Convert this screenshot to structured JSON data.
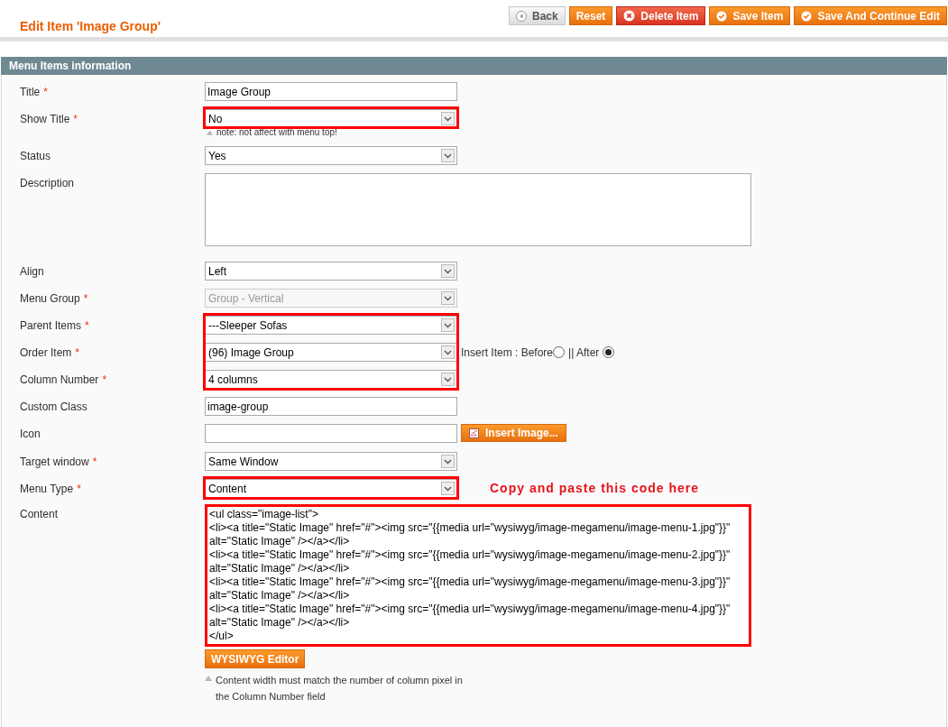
{
  "required_mark": "*",
  "header": {
    "title": "Edit Item 'Image Group'",
    "buttons": [
      {
        "label": "Back",
        "kind": "back"
      },
      {
        "label": "Reset",
        "kind": "plain"
      },
      {
        "label": "Delete Item",
        "kind": "delete"
      },
      {
        "label": "Save Item",
        "kind": "save"
      },
      {
        "label": "Save And Continue Edit",
        "kind": "save"
      }
    ]
  },
  "section": {
    "title": "Menu Items information",
    "fields": [
      {
        "kind": "text",
        "label": "Title",
        "required": true,
        "value": "Image Group",
        "highlighted": false
      },
      {
        "kind": "select",
        "label": "Show Title",
        "required": true,
        "value": "No",
        "disabled": false,
        "highlighted": true,
        "note": "note: not affect with menu top!"
      },
      {
        "kind": "select",
        "label": "Status",
        "required": false,
        "value": "Yes",
        "disabled": false,
        "highlighted": false
      },
      {
        "kind": "textarea",
        "label": "Description",
        "required": false,
        "highlighted": false
      },
      {
        "kind": "select",
        "label": "Align",
        "required": false,
        "value": "Left",
        "disabled": false,
        "highlighted": false
      },
      {
        "kind": "select",
        "label": "Menu Group",
        "required": true,
        "value": "Group - Vertical",
        "disabled": true,
        "highlighted": false
      },
      {
        "kind": "select",
        "label": "Parent Items",
        "required": true,
        "value": "---Sleeper Sofas",
        "disabled": false,
        "highlighted": true
      },
      {
        "kind": "select",
        "label": "Order Item",
        "required": true,
        "value": "(96) Image Group",
        "disabled": false,
        "highlighted": true,
        "insert": {
          "label": "Insert Item : Before",
          "separator": "|| After",
          "options": [
            {
              "selected": false
            },
            {
              "selected": true
            }
          ]
        }
      },
      {
        "kind": "select",
        "label": "Column Number",
        "required": true,
        "value": "4 columns",
        "disabled": false,
        "highlighted": true
      },
      {
        "kind": "text",
        "label": "Custom Class",
        "required": false,
        "value": "image-group",
        "highlighted": false
      },
      {
        "kind": "image",
        "label": "Icon",
        "required": false,
        "button": "Insert Image...",
        "highlighted": false
      },
      {
        "kind": "select",
        "label": "Target window",
        "required": true,
        "value": "Same Window",
        "disabled": false,
        "highlighted": false
      },
      {
        "kind": "select",
        "label": "Menu Type",
        "required": true,
        "value": "Content",
        "disabled": false,
        "highlighted": true,
        "annotation": "Copy and paste this code here"
      },
      {
        "kind": "code",
        "label": "Content",
        "required": false,
        "highlighted": true,
        "value": "<ul class=\"image-list\">\n<li><a title=\"Static Image\" href=\"#\"><img src=\"{{media url=\"wysiwyg/image-megamenu/image-menu-1.jpg\"}}\" alt=\"Static Image\" /></a></li>\n<li><a title=\"Static Image\" href=\"#\"><img src=\"{{media url=\"wysiwyg/image-megamenu/image-menu-2.jpg\"}}\" alt=\"Static Image\" /></a></li>\n<li><a title=\"Static Image\" href=\"#\"><img src=\"{{media url=\"wysiwyg/image-megamenu/image-menu-3.jpg\"}}\" alt=\"Static Image\" /></a></li>\n<li><a title=\"Static Image\" href=\"#\"><img src=\"{{media url=\"wysiwyg/image-megamenu/image-menu-4.jpg\"}}\" alt=\"Static Image\" /></a></li>\n</ul>",
        "button": "WYSIWYG Editor",
        "note": "Content width must match the number of column pixel in the Column Number field"
      }
    ]
  }
}
